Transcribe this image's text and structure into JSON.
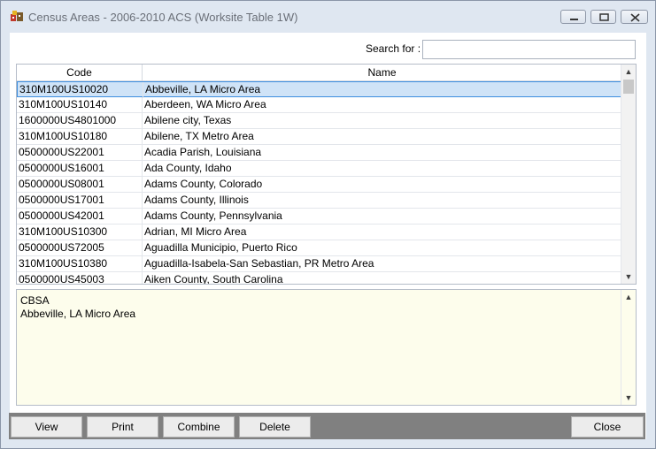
{
  "window": {
    "title": "Census Areas - 2006-2010 ACS (Worksite Table 1W)"
  },
  "search": {
    "label": "Search for :",
    "value": ""
  },
  "grid": {
    "columns": [
      "Code",
      "Name"
    ],
    "selected_index": 0,
    "rows": [
      {
        "code": "310M100US10020",
        "name": "Abbeville, LA Micro Area"
      },
      {
        "code": "310M100US10140",
        "name": "Aberdeen, WA Micro Area"
      },
      {
        "code": "1600000US4801000",
        "name": "Abilene city, Texas"
      },
      {
        "code": "310M100US10180",
        "name": "Abilene, TX Metro Area"
      },
      {
        "code": "0500000US22001",
        "name": "Acadia Parish, Louisiana"
      },
      {
        "code": "0500000US16001",
        "name": "Ada County, Idaho"
      },
      {
        "code": "0500000US08001",
        "name": "Adams County, Colorado"
      },
      {
        "code": "0500000US17001",
        "name": "Adams County, Illinois"
      },
      {
        "code": "0500000US42001",
        "name": "Adams County, Pennsylvania"
      },
      {
        "code": "310M100US10300",
        "name": "Adrian, MI Micro Area"
      },
      {
        "code": "0500000US72005",
        "name": "Aguadilla Municipio, Puerto Rico"
      },
      {
        "code": "310M100US10380",
        "name": "Aguadilla-Isabela-San Sebastian, PR Metro Area"
      },
      {
        "code": "0500000US45003",
        "name": "Aiken County, South Carolina"
      }
    ]
  },
  "detail": {
    "line1": "CBSA",
    "line2": "Abbeville, LA Micro Area"
  },
  "buttons": {
    "view": "View",
    "print": "Print",
    "combine": "Combine",
    "delete": "Delete",
    "close": "Close"
  },
  "icons": {
    "app": "app-icon",
    "minimize": "minimize-icon",
    "maximize": "maximize-icon",
    "close": "close-icon",
    "scroll_up": "chevron-up-icon",
    "scroll_down": "chevron-down-icon"
  }
}
